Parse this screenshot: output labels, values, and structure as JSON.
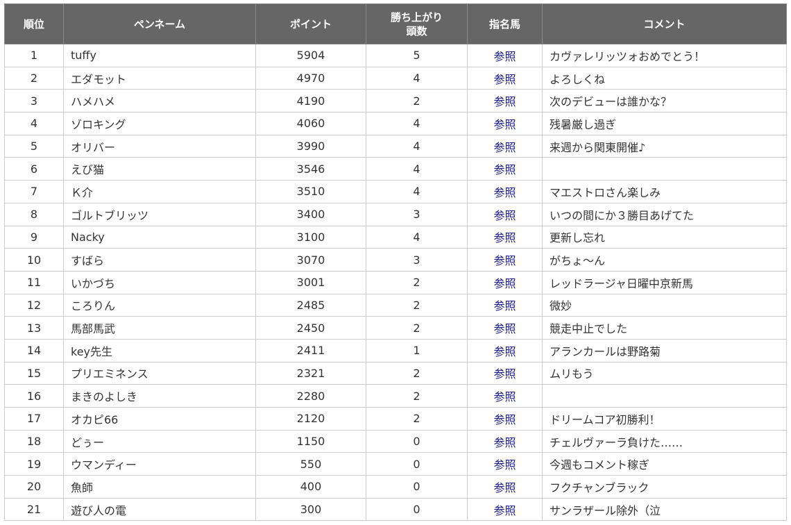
{
  "headers": {
    "rank": "順位",
    "pen_name": "ペンネーム",
    "points": "ポイント",
    "wins_line1": "勝ち上がり",
    "wins_line2": "頭数",
    "nominated": "指名馬",
    "comment": "コメント"
  },
  "link_label": "参照",
  "rows": [
    {
      "rank": "1",
      "name": "tuffy",
      "points": "5904",
      "wins": "5",
      "link": "参照",
      "comment": "カヴァレリッツォおめでとう！"
    },
    {
      "rank": "2",
      "name": "エダモット",
      "points": "4970",
      "wins": "4",
      "link": "参照",
      "comment": "よろしくね"
    },
    {
      "rank": "3",
      "name": "ハメハメ",
      "points": "4190",
      "wins": "2",
      "link": "参照",
      "comment": "次のデビューは誰かな？"
    },
    {
      "rank": "4",
      "name": "ゾロキング",
      "points": "4060",
      "wins": "4",
      "link": "参照",
      "comment": "残暑厳し過ぎ"
    },
    {
      "rank": "5",
      "name": "オリバー",
      "points": "3990",
      "wins": "4",
      "link": "参照",
      "comment": "来週から関東開催♪"
    },
    {
      "rank": "6",
      "name": "えび猫",
      "points": "3546",
      "wins": "4",
      "link": "参照",
      "comment": ""
    },
    {
      "rank": "7",
      "name": "Ｋ介",
      "points": "3510",
      "wins": "4",
      "link": "参照",
      "comment": "マエストロさん楽しみ"
    },
    {
      "rank": "8",
      "name": "ゴルトブリッツ",
      "points": "3400",
      "wins": "3",
      "link": "参照",
      "comment": "いつの間にか３勝目あげてた"
    },
    {
      "rank": "9",
      "name": "Nacky",
      "points": "3100",
      "wins": "4",
      "link": "参照",
      "comment": "更新し忘れ"
    },
    {
      "rank": "10",
      "name": "すばら",
      "points": "3070",
      "wins": "3",
      "link": "参照",
      "comment": "がちょ～ん"
    },
    {
      "rank": "11",
      "name": "いかづち",
      "points": "3001",
      "wins": "2",
      "link": "参照",
      "comment": "レッドラージャ日曜中京新馬"
    },
    {
      "rank": "12",
      "name": "ころりん",
      "points": "2485",
      "wins": "2",
      "link": "参照",
      "comment": "微妙"
    },
    {
      "rank": "13",
      "name": "馬部馬武",
      "points": "2450",
      "wins": "2",
      "link": "参照",
      "comment": "競走中止でした"
    },
    {
      "rank": "14",
      "name": "key先生",
      "points": "2411",
      "wins": "1",
      "link": "参照",
      "comment": "アランカールは野路菊"
    },
    {
      "rank": "15",
      "name": "プリエミネンス",
      "points": "2321",
      "wins": "2",
      "link": "参照",
      "comment": "ムリもう"
    },
    {
      "rank": "16",
      "name": "まきのよしき",
      "points": "2280",
      "wins": "2",
      "link": "参照",
      "comment": ""
    },
    {
      "rank": "17",
      "name": "オカピ66",
      "points": "2120",
      "wins": "2",
      "link": "参照",
      "comment": "ドリームコア初勝利！"
    },
    {
      "rank": "18",
      "name": "どぅー",
      "points": "1150",
      "wins": "0",
      "link": "参照",
      "comment": "チェルヴァーラ負けた……"
    },
    {
      "rank": "19",
      "name": "ウマンディー",
      "points": "550",
      "wins": "0",
      "link": "参照",
      "comment": "今週もコメント稼ぎ"
    },
    {
      "rank": "20",
      "name": "魚師",
      "points": "400",
      "wins": "0",
      "link": "参照",
      "comment": "フクチャンブラック"
    },
    {
      "rank": "21",
      "name": "遊び人の電",
      "points": "300",
      "wins": "0",
      "link": "参照",
      "comment": "サンラザール除外（泣"
    }
  ],
  "colors": {
    "header_bg": "#666666",
    "header_text": "#ffffff",
    "border": "#cccccc",
    "link": "#1a1a8c",
    "text": "#333333"
  }
}
